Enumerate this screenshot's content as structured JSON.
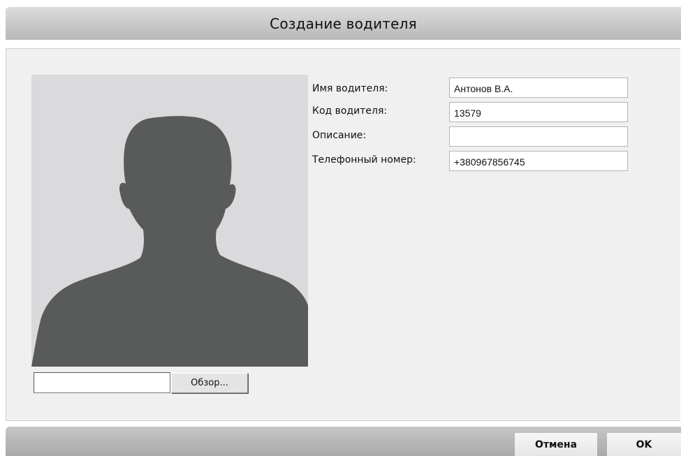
{
  "dialog": {
    "title": "Создание водителя"
  },
  "photo": {
    "file_path_value": "",
    "browse_label": "Обзор..."
  },
  "form": {
    "fields": [
      {
        "label": "Имя водителя:",
        "value": "Антонов В.А."
      },
      {
        "label": "Код водителя:",
        "value": "13579"
      },
      {
        "label": "Описание:",
        "value": ""
      },
      {
        "label": "Телефонный номер:",
        "value": "+380967856745"
      }
    ]
  },
  "footer": {
    "cancel_label": "Отмена",
    "ok_label": "OK"
  },
  "colors": {
    "silhouette": "#595a5a",
    "photo_background": "#dadadd",
    "body_background": "#f0f0f0"
  }
}
